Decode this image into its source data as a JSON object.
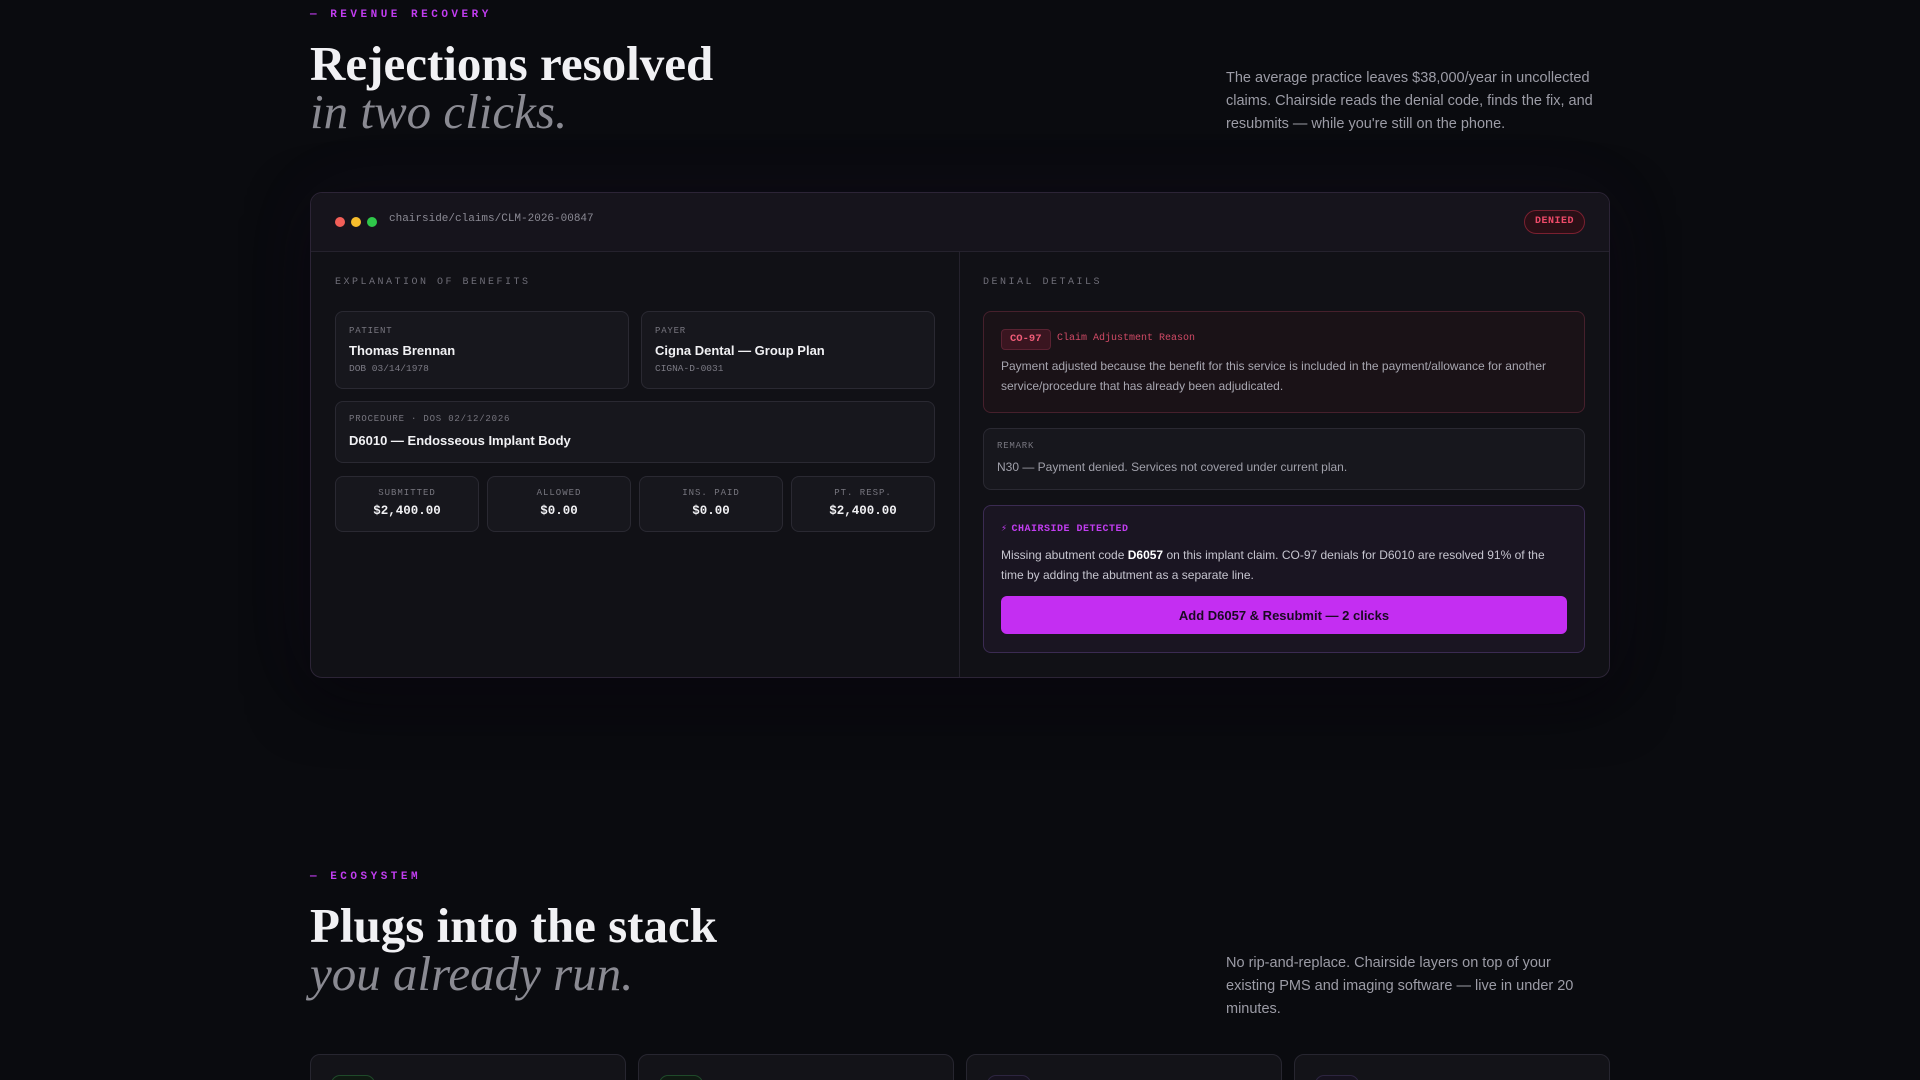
{
  "revenue": {
    "eyebrow": "— REVENUE RECOVERY",
    "title": "Rejections resolved",
    "title_sub": "in two clicks.",
    "lede": "The average practice leaves $38,000/year in uncollected claims. Chairside reads the denial code, finds the fix, and resubmits — while you're still on the phone."
  },
  "window": {
    "url": "chairside/claims/CLM-2026-00847",
    "status_badge": "DENIED"
  },
  "eob": {
    "label": "EXPLANATION OF BENEFITS",
    "patient": {
      "key": "PATIENT",
      "name": "Thomas Brennan",
      "sub": "DOB 03/14/1978"
    },
    "payer": {
      "key": "PAYER",
      "name": "Cigna Dental — Group Plan",
      "sub": "CIGNA-D-0031"
    },
    "procedure": {
      "key": "PROCEDURE · DOS 02/12/2026",
      "name": "D6010 — Endosseous Implant Body"
    },
    "stats": [
      {
        "key": "SUBMITTED",
        "value": "$2,400.00"
      },
      {
        "key": "ALLOWED",
        "value": "$0.00"
      },
      {
        "key": "INS. PAID",
        "value": "$0.00"
      },
      {
        "key": "PT. RESP.",
        "value": "$2,400.00"
      }
    ]
  },
  "denial": {
    "label": "DENIAL DETAILS",
    "code": "CO-97",
    "code_desc": "Claim Adjustment Reason",
    "reason": "Payment adjusted because the benefit for this service is included in the payment/allowance for another service/procedure that has already been adjudicated.",
    "remark_key": "REMARK",
    "remark": "N30 — Payment denied. Services not covered under current plan."
  },
  "detected": {
    "icon": "lightning-icon",
    "bolt": "⚡",
    "head": "CHAIRSIDE DETECTED",
    "text_pre": "Missing abutment code ",
    "text_code": "D6057",
    "text_post": " on this implant claim. CO-97 denials for D6010 are resolved 91% of the time by adding the abutment as a separate line.",
    "cta": "Add D6057 & Resubmit — 2 clicks"
  },
  "ecosystem": {
    "eyebrow": "— ECOSYSTEM",
    "title": "Plugs into the stack",
    "title_sub": "you already run.",
    "lede": "No rip-and-replace. Chairside layers on top of your existing PMS and imaging software — live in under 20 minutes."
  },
  "colors": {
    "accent": "#c42ef2",
    "background": "#0a0b0f",
    "denied": "#f04b6a"
  }
}
